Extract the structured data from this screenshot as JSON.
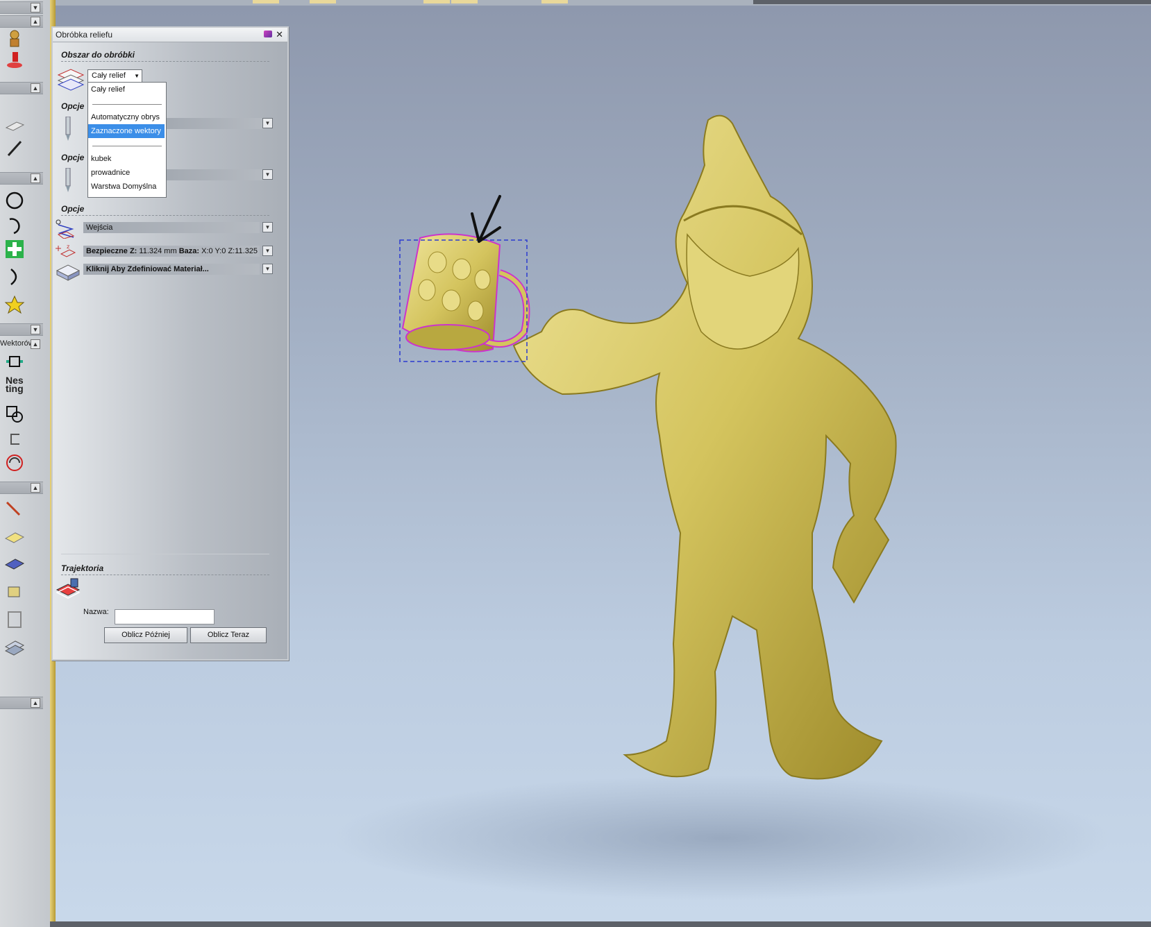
{
  "panel": {
    "title": "Obróbka reliefu",
    "section_area": "Obszar do obróbki",
    "combo_value": "Cały relief",
    "section_options1": "Opcje",
    "section_options2": "Opcje",
    "section_options3": "Opcje",
    "dropdown_items": [
      "Cały relief",
      "Automatyczny obrys",
      "Zaznaczone wektory",
      "kubek",
      "prowadnice",
      "Warstwa Domyślna"
    ],
    "selected_item": "Zaznaczone wektory",
    "inputs_bar": "Wejścia",
    "safe_z_label": "Bezpieczne Z:",
    "safe_z_value": "11.324 mm",
    "base_label": "Baza:",
    "base_value": "X:0 Y:0 Z:11.325",
    "material_bar": "Kliknij Aby Zdefiniować Materiał...",
    "trajectory_section": "Trajektoria",
    "name_label": "Nazwa:",
    "name_value": "",
    "btn_later": "Oblicz Później",
    "btn_now": "Oblicz Teraz"
  },
  "toolbar": {
    "vectors_label": "Wektorów"
  },
  "icons": [
    "close-icon",
    "pin-icon",
    "area-icon",
    "tool-icon",
    "inputs-icon",
    "safe-z-icon",
    "material-icon",
    "toolpath-icon",
    "circle-icon",
    "arc-icon",
    "add-icon",
    "star-icon",
    "nesting-icon",
    "boolean-icon",
    "spiral-icon",
    "pencil-icon",
    "layer-icon"
  ],
  "colors": {
    "selection": "#3b8ee8",
    "relief": "#d9cc6a",
    "vector_outline": "#cc33cc",
    "bbox": "#2a3ad0"
  }
}
